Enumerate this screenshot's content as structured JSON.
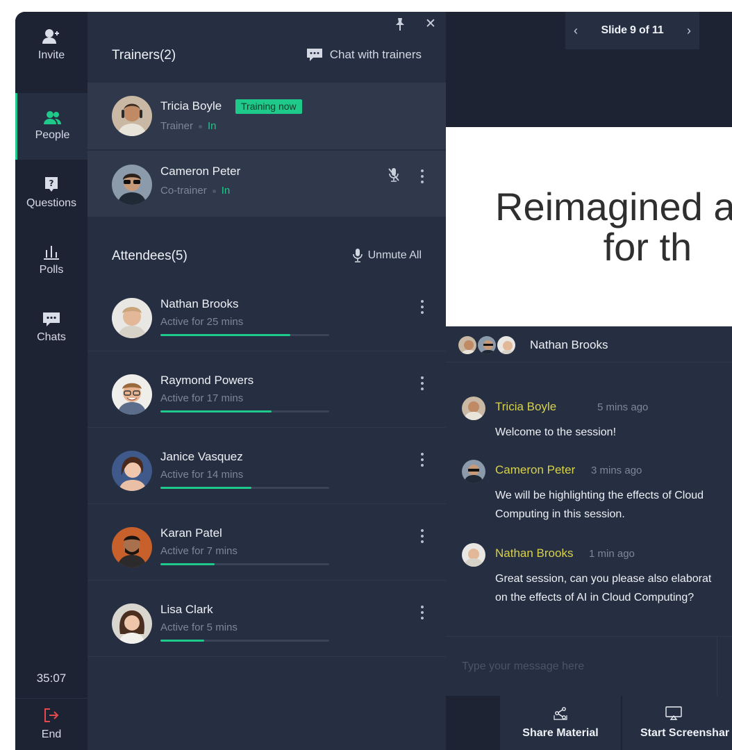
{
  "rail": {
    "invite": "Invite",
    "people": "People",
    "questions": "Questions",
    "polls": "Polls",
    "chats": "Chats",
    "timer": "35:07",
    "end": "End"
  },
  "panel": {
    "trainers_title": "Trainers(2)",
    "chat_with_trainers": "Chat with trainers",
    "trainers": [
      {
        "name": "Tricia Boyle",
        "role": "Trainer",
        "status": "In",
        "badge": "Training now"
      },
      {
        "name": "Cameron Peter",
        "role": "Co-trainer",
        "status": "In"
      }
    ],
    "attendees_title": "Attendees(5)",
    "unmute_all": "Unmute All",
    "attendees": [
      {
        "name": "Nathan Brooks",
        "active": "Active for 25 mins",
        "progress": 0.77
      },
      {
        "name": "Raymond Powers",
        "active": "Active for 17 mins",
        "progress": 0.66
      },
      {
        "name": "Janice Vasquez",
        "active": "Active for 14 mins",
        "progress": 0.54
      },
      {
        "name": "Karan Patel",
        "active": "Active for 7 mins",
        "progress": 0.32
      },
      {
        "name": "Lisa Clark",
        "active": "Active for 5 mins",
        "progress": 0.26
      }
    ]
  },
  "slide": {
    "nav_label": "Slide 9 of 11",
    "text": "Reimagined a\n          for th"
  },
  "chat": {
    "header_name": "Nathan Brooks",
    "messages": [
      {
        "name": "Tricia Boyle",
        "time": "5 mins ago",
        "text": "Welcome to the session!"
      },
      {
        "name": "Cameron Peter",
        "time": "3 mins ago",
        "text": "We will be highlighting the effects of Cloud\nComputing in this session."
      },
      {
        "name": "Nathan Brooks",
        "time": "1 min ago",
        "text": "Great session, can you please also elaborat\non the effects of AI in Cloud Computing?"
      }
    ],
    "input_placeholder": "Type your message here"
  },
  "toolbar": {
    "share_material": "Share Material",
    "start_screenshare": "Start Screenshar"
  },
  "colors": {
    "accent": "#1fc98a",
    "chat_name": "#d8d24a",
    "end_icon": "#e5484d"
  }
}
